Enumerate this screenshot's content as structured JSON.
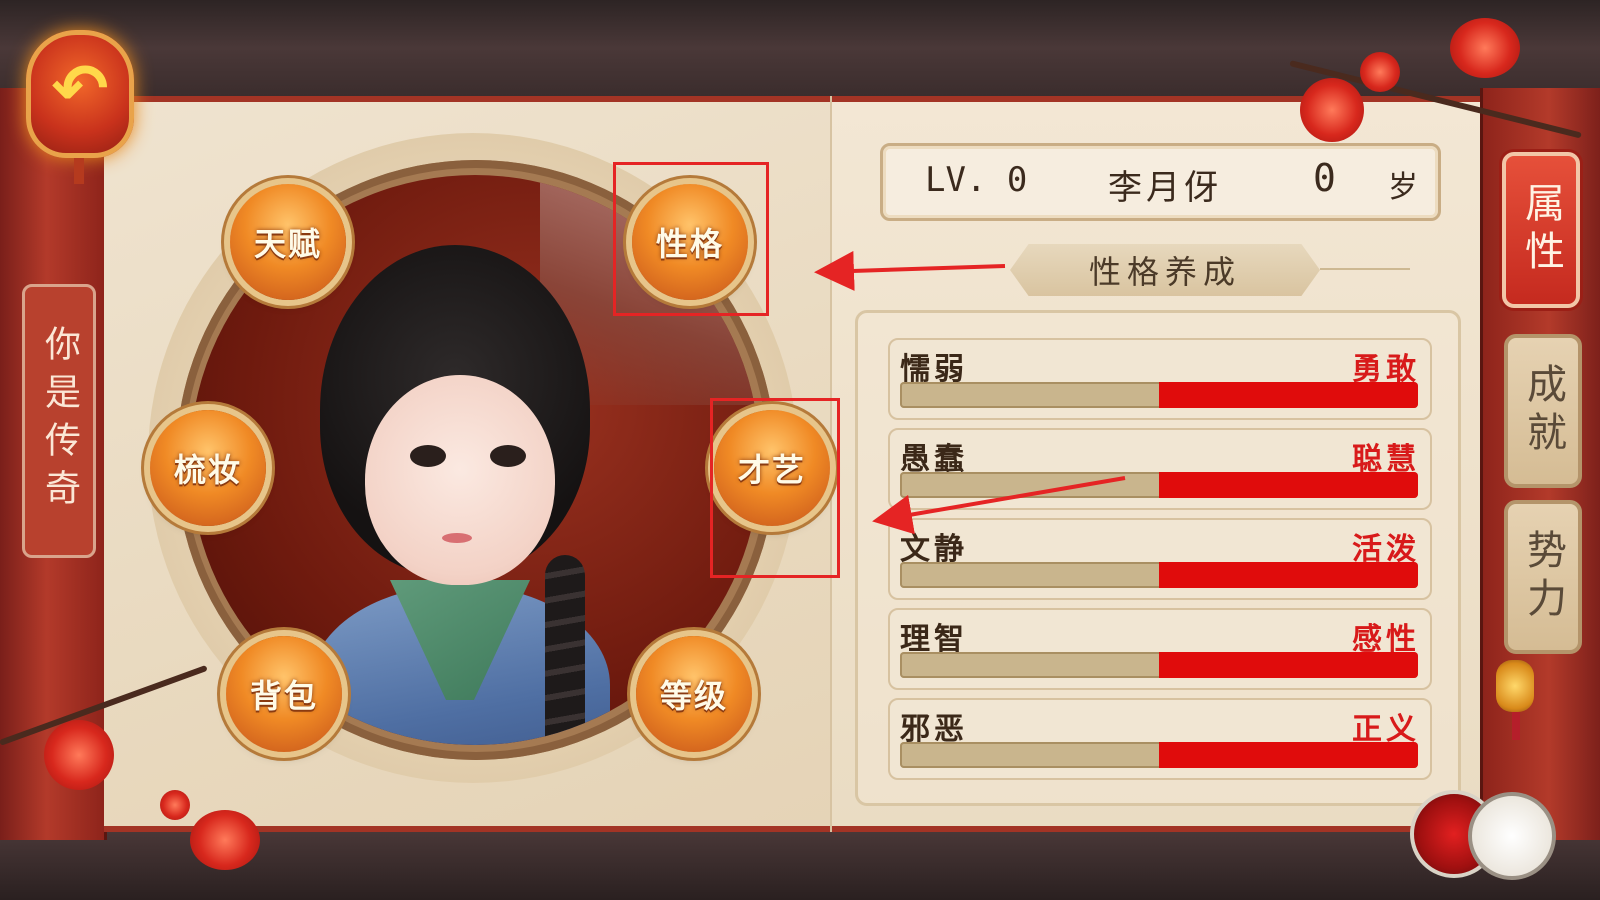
{
  "back_button": {
    "icon": "back-arrow-icon"
  },
  "left_title": "你是传奇",
  "character": {
    "level_label": "LV.",
    "level": "0",
    "name": "李月伢",
    "age": "0",
    "age_unit": "岁"
  },
  "menu_buttons": {
    "talent": "天赋",
    "personality": "性格",
    "dressing": "梳妆",
    "skills": "才艺",
    "bag": "背包",
    "rank": "等级"
  },
  "section_title": "性格养成",
  "traits": [
    {
      "left": "懦弱",
      "right": "勇敢",
      "value": 0.5
    },
    {
      "left": "愚蠢",
      "right": "聪慧",
      "value": 0.5
    },
    {
      "left": "文静",
      "right": "活泼",
      "value": 0.5
    },
    {
      "left": "理智",
      "right": "感性",
      "value": 0.5
    },
    {
      "left": "邪恶",
      "right": "正义",
      "value": 0.5
    }
  ],
  "side_tabs": [
    {
      "label": "属性",
      "active": true
    },
    {
      "label": "成就",
      "active": false
    },
    {
      "label": "势力",
      "active": false
    }
  ],
  "colors": {
    "accent_red": "#e00c0c",
    "highlight_box": "#e52424",
    "button_orange": "#f08a25"
  }
}
